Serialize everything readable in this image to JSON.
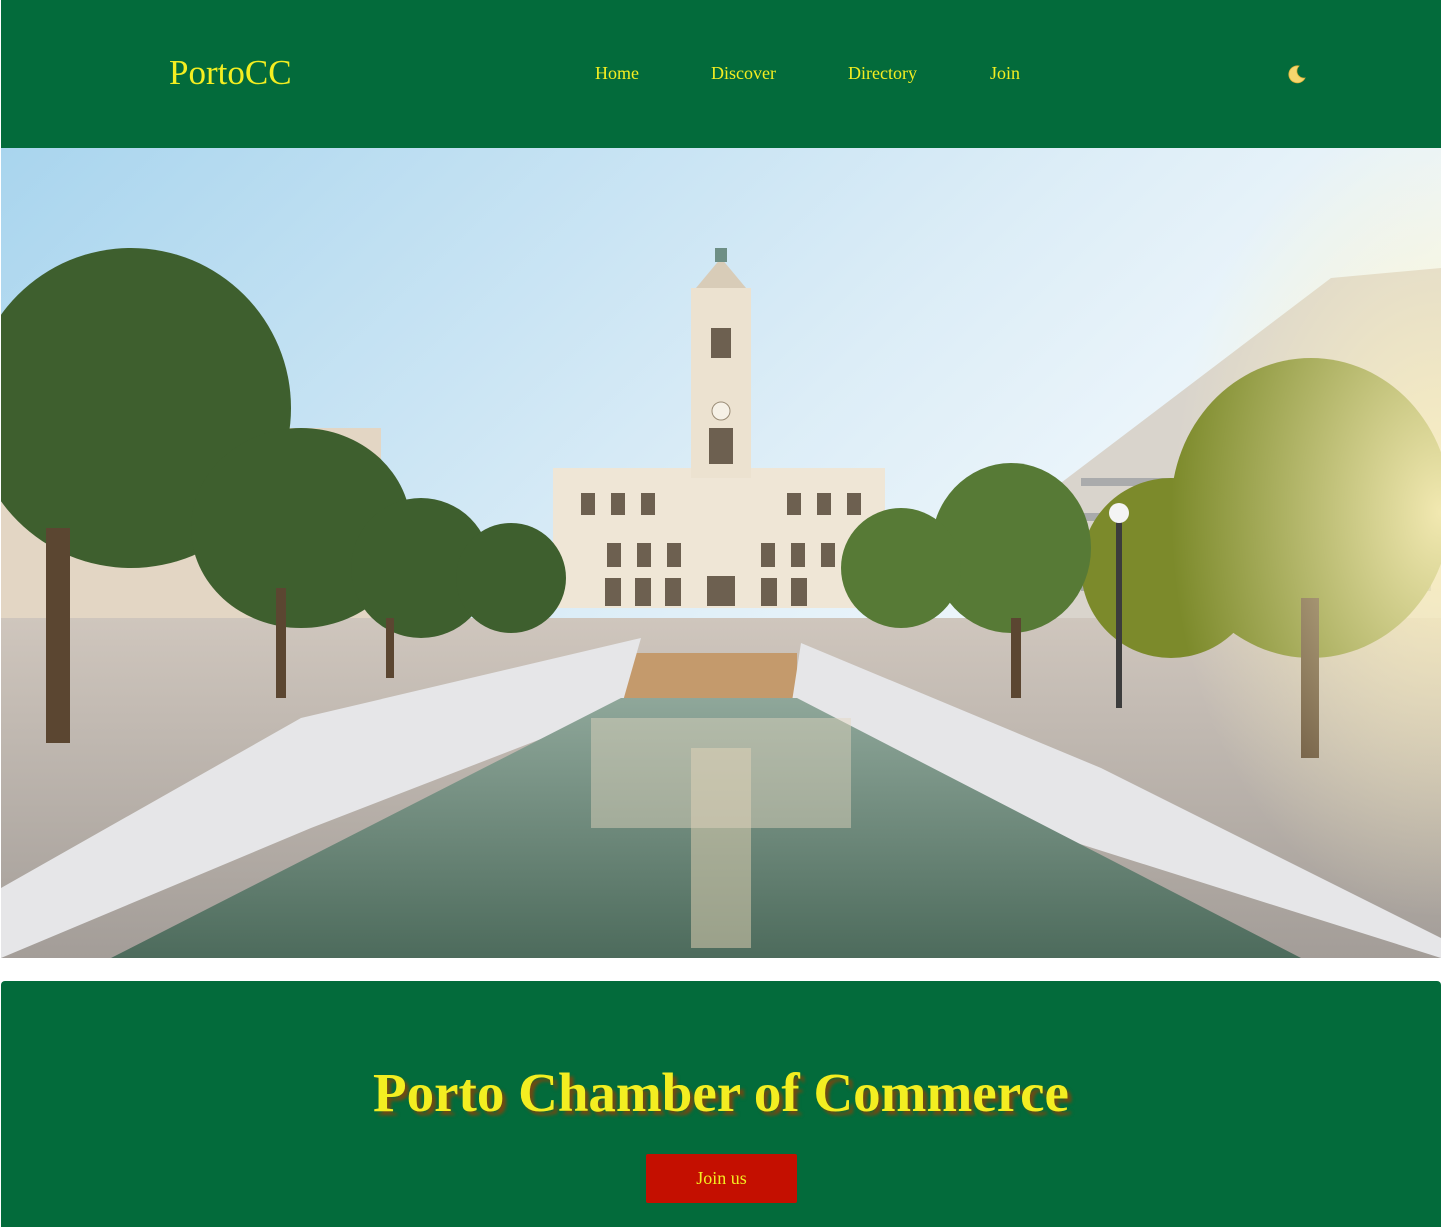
{
  "header": {
    "logo": "PortoCC",
    "nav": [
      {
        "label": "Home"
      },
      {
        "label": "Discover"
      },
      {
        "label": "Directory"
      },
      {
        "label": "Join"
      }
    ],
    "theme_toggle_icon": "moon-icon"
  },
  "hero": {
    "image": "porto-city-hall-photo"
  },
  "banner": {
    "title": "Porto Chamber of Commerce",
    "button_label": "Join us"
  },
  "colors": {
    "primary_green": "#036b3b",
    "accent_yellow": "#f3ee21",
    "button_red": "#c40f00"
  }
}
